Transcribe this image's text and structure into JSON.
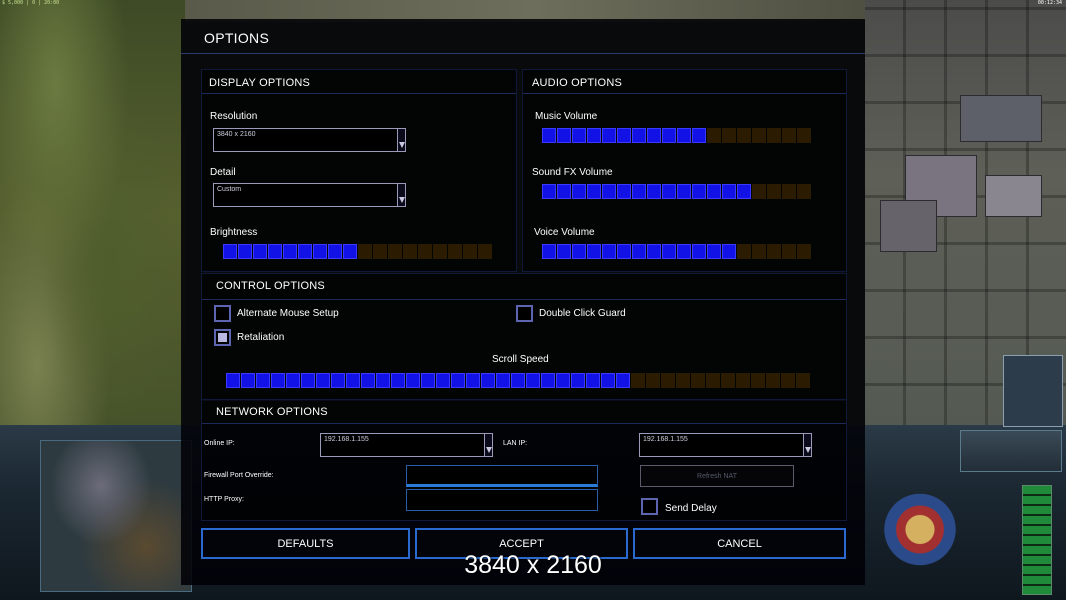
{
  "hud": {
    "top_left_stats": "$ 5,000 | 0 | 20:00",
    "top_right_clock": "00:12:34"
  },
  "dialog": {
    "title": "OPTIONS",
    "display": {
      "heading": "DISPLAY OPTIONS",
      "resolution_label": "Resolution",
      "resolution_value": "3840 x 2160",
      "detail_label": "Detail",
      "detail_value": "Custom",
      "brightness_label": "Brightness",
      "brightness_level": 0.5
    },
    "audio": {
      "heading": "AUDIO OPTIONS",
      "music_label": "Music Volume",
      "music_level": 0.6,
      "sfx_label": "Sound FX Volume",
      "sfx_level": 0.8,
      "voice_label": "Voice Volume",
      "voice_level": 0.7
    },
    "control": {
      "heading": "CONTROL OPTIONS",
      "alt_mouse_label": "Alternate Mouse Setup",
      "alt_mouse_checked": false,
      "double_click_label": "Double Click Guard",
      "double_click_checked": false,
      "retaliation_label": "Retaliation",
      "retaliation_checked": true,
      "scroll_label": "Scroll Speed",
      "scroll_level": 0.69
    },
    "network": {
      "heading": "NETWORK OPTIONS",
      "online_ip_label": "Online IP:",
      "online_ip_value": "192.168.1.155",
      "lan_ip_label": "LAN IP:",
      "lan_ip_value": "192.168.1.155",
      "firewall_label": "Firewall Port Override:",
      "firewall_value": "",
      "http_proxy_label": "HTTP Proxy:",
      "http_proxy_value": "",
      "refresh_nat_label": "Refresh NAT",
      "send_delay_label": "Send Delay",
      "send_delay_checked": false
    },
    "buttons": {
      "defaults": "DEFAULTS",
      "accept": "ACCEPT",
      "cancel": "CANCEL"
    }
  },
  "overlay_caption": "3840 x 2160"
}
